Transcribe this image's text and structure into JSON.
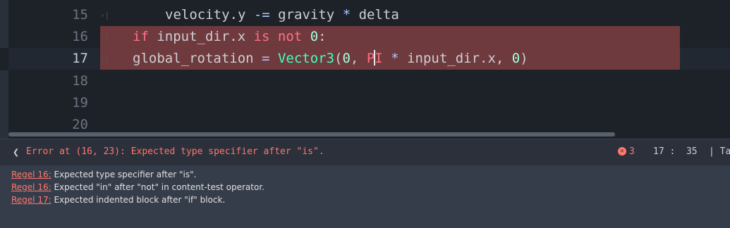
{
  "editor": {
    "lines": [
      {
        "num": "15",
        "parts": [
          {
            "t": "velocity.y ",
            "c": ""
          },
          {
            "t": "-=",
            "c": "op"
          },
          {
            "t": " gravity ",
            "c": ""
          },
          {
            "t": "*",
            "c": "op"
          },
          {
            "t": " delta",
            "c": ""
          }
        ]
      },
      {
        "num": "16",
        "parts": [
          {
            "t": "if",
            "c": "kw"
          },
          {
            "t": " input_dir.x ",
            "c": ""
          },
          {
            "t": "is not",
            "c": "kw"
          },
          {
            "t": " ",
            "c": ""
          },
          {
            "t": "0",
            "c": "num"
          },
          {
            "t": ":",
            "c": ""
          }
        ]
      },
      {
        "num": "17",
        "parts": [
          {
            "t": "global_rotation ",
            "c": ""
          },
          {
            "t": "=",
            "c": "op"
          },
          {
            "t": " ",
            "c": ""
          },
          {
            "t": "Vector3",
            "c": "ty"
          },
          {
            "t": "(",
            "c": ""
          },
          {
            "t": "0",
            "c": "num"
          },
          {
            "t": ", ",
            "c": ""
          },
          {
            "t": "P",
            "c": "kw"
          },
          {
            "t": "|CARET|",
            "c": "caret"
          },
          {
            "t": "I",
            "c": "kw"
          },
          {
            "t": " ",
            "c": ""
          },
          {
            "t": "*",
            "c": "op"
          },
          {
            "t": " input_dir.x, ",
            "c": ""
          },
          {
            "t": "0",
            "c": "num"
          },
          {
            "t": ")",
            "c": ""
          }
        ]
      },
      {
        "num": "18",
        "parts": []
      },
      {
        "num": "19",
        "parts": []
      },
      {
        "num": "20",
        "parts": []
      }
    ]
  },
  "status": {
    "error_message": "Error at (16, 23): Expected type specifier after \"is\".",
    "error_count": "3",
    "position": "17 :  35",
    "indent": "| Tabs"
  },
  "errors_panel": [
    {
      "link": "Regel 16:",
      "text": " Expected type specifier after \"is\"."
    },
    {
      "link": "Regel 16:",
      "text": " Expected \"in\" after \"not\" in content-test operator."
    },
    {
      "link": "Regel 17:",
      "text": " Expected indented block after \"if\" block."
    }
  ],
  "colors": {
    "keyword": "#ff7085",
    "number": "#a1ffe0",
    "type": "#42ffc2",
    "error": "#ff786b",
    "error_line_bg": "#6f3a3e"
  }
}
